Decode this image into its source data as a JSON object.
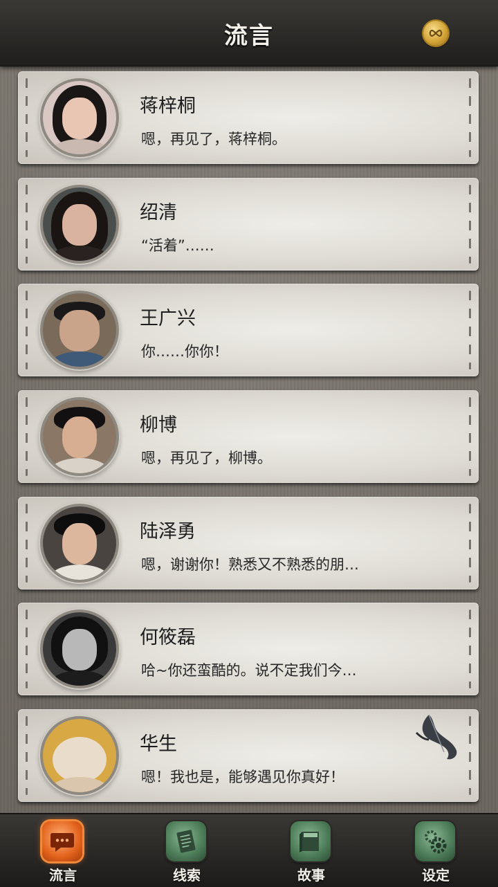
{
  "header": {
    "title": "流言"
  },
  "contacts": [
    {
      "name": "蒋梓桐",
      "message": "嗯，再见了，蒋梓桐。"
    },
    {
      "name": "绍清",
      "message": "“活着”……"
    },
    {
      "name": "王广兴",
      "message": "你……你你！"
    },
    {
      "name": "柳博",
      "message": "嗯，再见了，柳博。"
    },
    {
      "name": "陆泽勇",
      "message": "嗯，谢谢你！熟悉又不熟悉的朋…"
    },
    {
      "name": "何筱磊",
      "message": "哈~你还蛮酷的。说不定我们今…"
    },
    {
      "name": "华生",
      "message": "嗯！我也是，能够遇见你真好！"
    }
  ],
  "nav": {
    "items": [
      {
        "label": "流言",
        "icon": "chat-bubble-icon",
        "active": true
      },
      {
        "label": "线索",
        "icon": "notebook-icon",
        "active": false
      },
      {
        "label": "故事",
        "icon": "book-icon",
        "active": false
      },
      {
        "label": "设定",
        "icon": "gear-icon",
        "active": false
      }
    ]
  },
  "colors": {
    "header_bg": "#2b2a27",
    "card_bg": "#e2dfd8",
    "nav_active": "#e2621c",
    "nav_inactive": "#4b7a57"
  }
}
